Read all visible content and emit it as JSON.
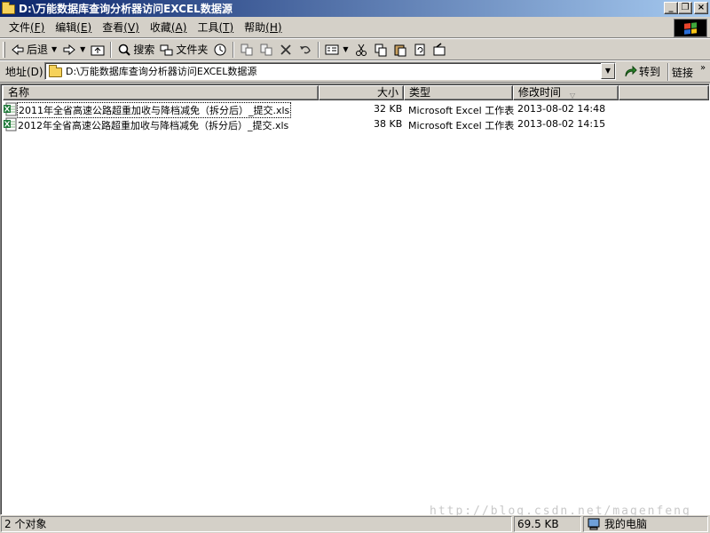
{
  "window": {
    "title": "D:\\万能数据库查询分析器访问EXCEL数据源",
    "controls": [
      "minimize",
      "restore",
      "close"
    ]
  },
  "menu": [
    {
      "label": "文件",
      "key": "(F)"
    },
    {
      "label": "编辑",
      "key": "(E)"
    },
    {
      "label": "查看",
      "key": "(V)"
    },
    {
      "label": "收藏",
      "key": "(A)"
    },
    {
      "label": "工具",
      "key": "(T)"
    },
    {
      "label": "帮助",
      "key": "(H)"
    }
  ],
  "toolbar": {
    "back_label": "后退",
    "search_label": "搜索",
    "folders_label": "文件夹"
  },
  "address": {
    "label": "地址(D)",
    "path": "D:\\万能数据库查询分析器访问EXCEL数据源",
    "goto_label": "转到",
    "links_label": "链接"
  },
  "columns": {
    "name": "名称",
    "size": "大小",
    "type": "类型",
    "modified": "修改时间"
  },
  "files": [
    {
      "name": "2011年全省高速公路超重加收与降档减免（拆分后）_提交.xls",
      "size": "32 KB",
      "type": "Microsoft Excel 工作表",
      "modified": "2013-08-02 14:48"
    },
    {
      "name": "2012年全省高速公路超重加收与降档减免（拆分后）_提交.xls",
      "size": "38 KB",
      "type": "Microsoft Excel 工作表",
      "modified": "2013-08-02 14:15"
    }
  ],
  "status": {
    "count": "2 个对象",
    "size": "69.5 KB",
    "location": "我的电脑"
  },
  "watermark": "http://blog.csdn.net/magenfeng",
  "colors": {
    "title_gradient_start": "#0a246a",
    "title_gradient_end": "#a6caf0",
    "chrome": "#d4d0c8",
    "excel_green": "#1f7a3a"
  }
}
